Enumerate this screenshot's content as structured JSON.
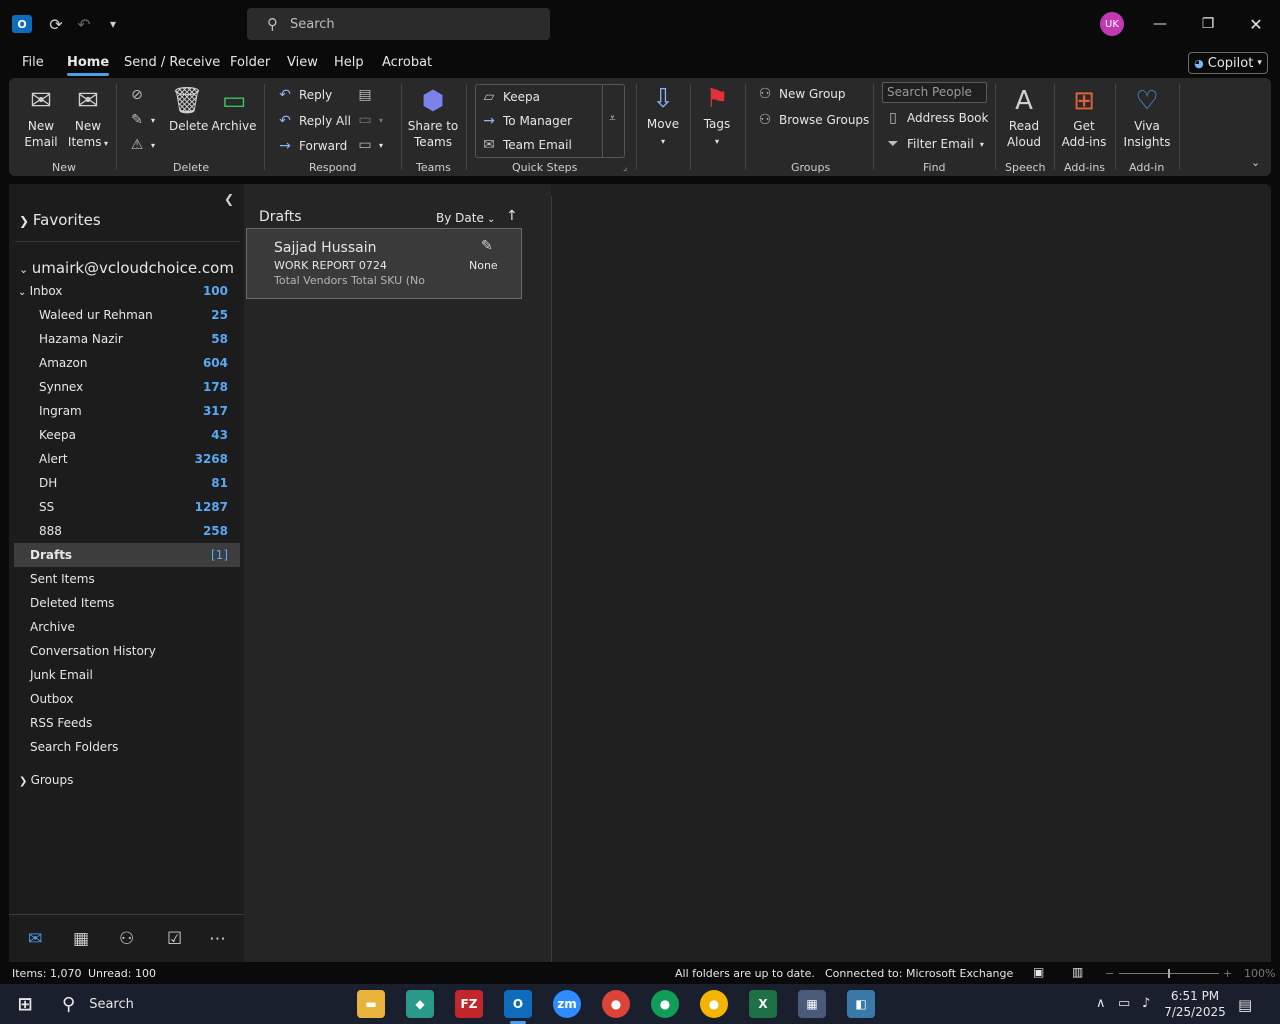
{
  "titlebar": {
    "search_placeholder": "Search",
    "avatar_initials": "UK"
  },
  "menu": [
    "File",
    "Home",
    "Send / Receive",
    "Folder",
    "View",
    "Help",
    "Acrobat"
  ],
  "copilot_label": "Copilot",
  "ribbon": {
    "new": {
      "new_email": "New\nEmail",
      "new_email_1": "New",
      "new_email_2": "Email",
      "new_items_1": "New",
      "new_items_2": "Items",
      "group": "New"
    },
    "delete": {
      "delete": "Delete",
      "archive": "Archive",
      "group": "Delete"
    },
    "respond": {
      "reply": "Reply",
      "reply_all": "Reply All",
      "forward": "Forward",
      "group": "Respond"
    },
    "teams": {
      "share_1": "Share to",
      "share_2": "Teams",
      "group": "Teams"
    },
    "quick_steps": {
      "items": [
        "Keepa",
        "To Manager",
        "Team Email"
      ],
      "group": "Quick Steps"
    },
    "move": {
      "label": "Move"
    },
    "tags": {
      "label": "Tags"
    },
    "groups": {
      "new_group": "New Group",
      "browse_groups": "Browse Groups",
      "group": "Groups"
    },
    "find": {
      "search_people": "Search People",
      "address_book": "Address Book",
      "filter_email": "Filter Email",
      "group": "Find"
    },
    "speech": {
      "read_1": "Read",
      "read_2": "Aloud",
      "group": "Speech"
    },
    "addins": {
      "get_1": "Get",
      "get_2": "Add-ins",
      "group": "Add-ins"
    },
    "addin": {
      "viva_1": "Viva",
      "viva_2": "Insights",
      "group": "Add-in"
    }
  },
  "nav": {
    "favorites": "Favorites",
    "account": "umairk@vcloudchoice.com",
    "inbox": {
      "name": "Inbox",
      "count": "100"
    },
    "subfolders": [
      {
        "name": "Waleed ur Rehman",
        "count": "25"
      },
      {
        "name": "Hazama Nazir",
        "count": "58"
      },
      {
        "name": "Amazon",
        "count": "604"
      },
      {
        "name": "Synnex",
        "count": "178"
      },
      {
        "name": "Ingram",
        "count": "317"
      },
      {
        "name": "Keepa",
        "count": "43"
      },
      {
        "name": "Alert",
        "count": "3268"
      },
      {
        "name": "DH",
        "count": "81"
      },
      {
        "name": "SS",
        "count": "1287"
      },
      {
        "name": "888",
        "count": "258"
      }
    ],
    "drafts": {
      "name": "Drafts",
      "count": "[1]"
    },
    "folders": [
      "Sent Items",
      "Deleted Items",
      "Archive",
      "Conversation History",
      "Junk Email",
      "Outbox",
      "RSS Feeds",
      "Search Folders"
    ],
    "groups": "Groups"
  },
  "list": {
    "title": "Drafts",
    "sort_label": "By Date",
    "message": {
      "from": "Sajjad Hussain",
      "subject": "WORK REPORT 0724",
      "preview": "Total Vendors  Total SKU (No",
      "category": "None"
    }
  },
  "status": {
    "items": "Items: 1,070",
    "unread": "Unread: 100",
    "sync": "All folders are up to date.",
    "connection": "Connected to: Microsoft Exchange",
    "zoom": "100%"
  },
  "taskbar": {
    "search": "Search",
    "time": "6:51 PM",
    "date": "7/25/2025"
  }
}
